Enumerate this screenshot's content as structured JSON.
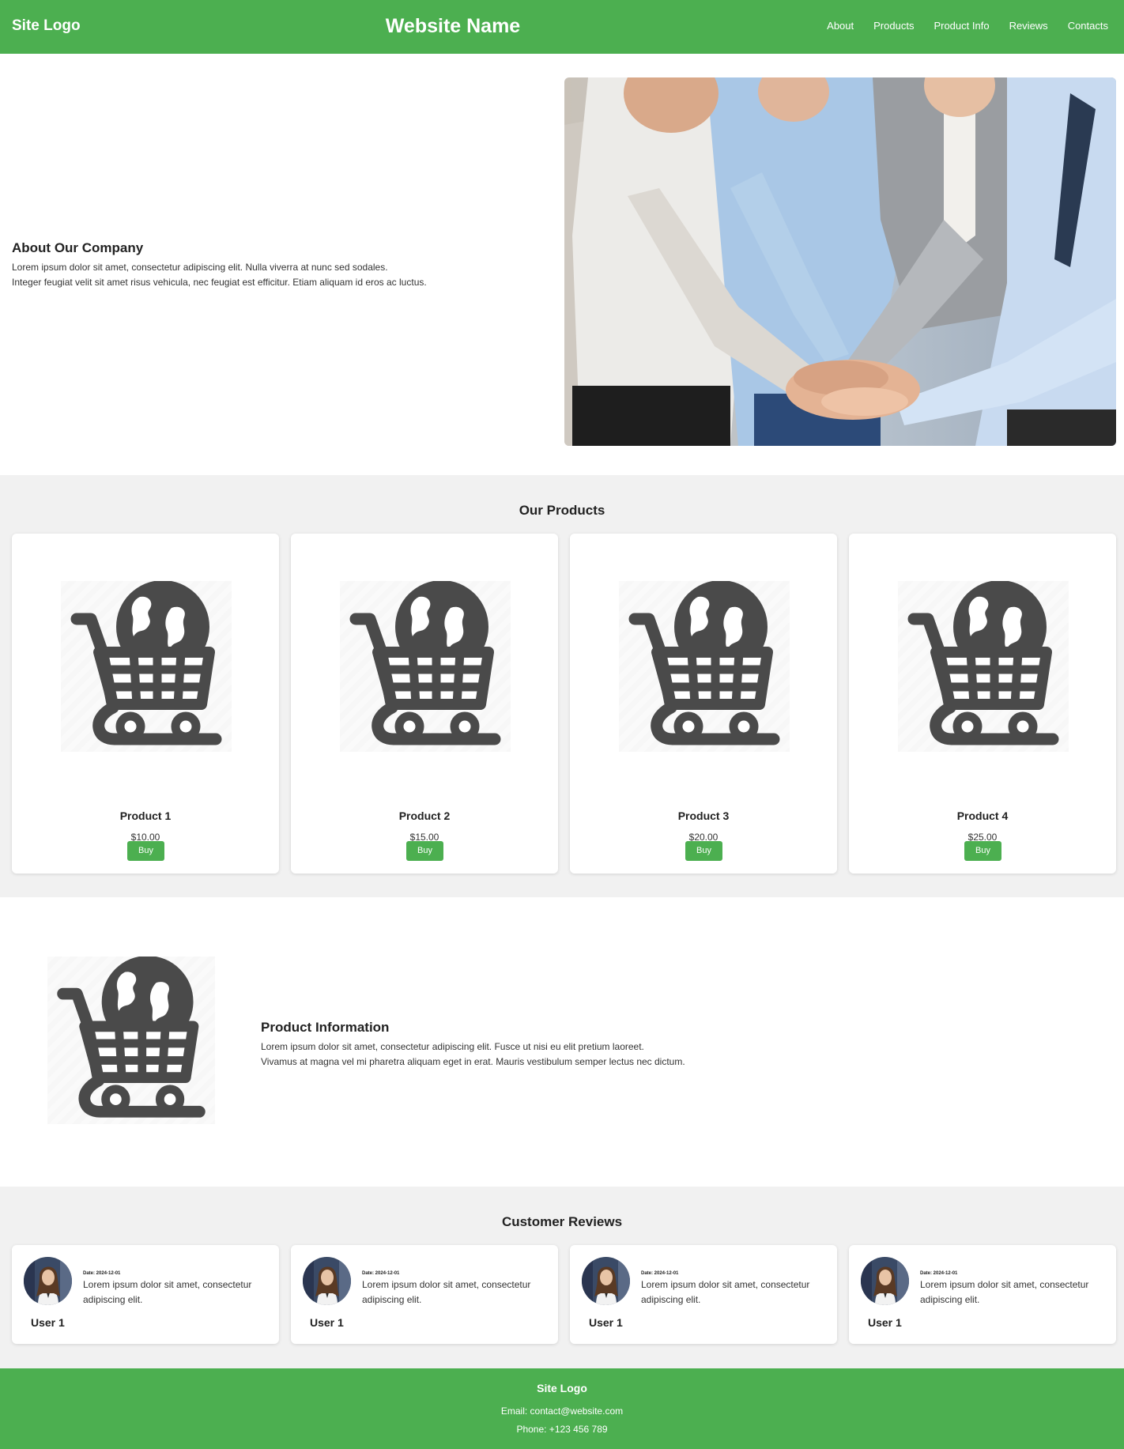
{
  "header": {
    "logo": "Site Logo",
    "site_name": "Website Name",
    "nav": [
      "About",
      "Products",
      "Product Info",
      "Reviews",
      "Contacts"
    ]
  },
  "about": {
    "title": "About Our Company",
    "line1": "Lorem ipsum dolor sit amet, consectetur adipiscing elit. Nulla viverra at nunc sed sodales.",
    "line2": "Integer feugiat velit sit amet risus vehicula, nec feugiat est efficitur. Etiam aliquam id eros ac luctus."
  },
  "products": {
    "title": "Our Products",
    "items": [
      {
        "name": "Product 1",
        "price": "$10.00",
        "button": "Buy"
      },
      {
        "name": "Product 2",
        "price": "$15.00",
        "button": "Buy"
      },
      {
        "name": "Product 3",
        "price": "$20.00",
        "button": "Buy"
      },
      {
        "name": "Product 4",
        "price": "$25.00",
        "button": "Buy"
      }
    ]
  },
  "product_info": {
    "title": "Product Information",
    "line1": "Lorem ipsum dolor sit amet, consectetur adipiscing elit. Fusce ut nisi eu elit pretium laoreet.",
    "line2": "Vivamus at magna vel mi pharetra aliquam eget in erat. Mauris vestibulum semper lectus nec dictum."
  },
  "reviews": {
    "title": "Customer Reviews",
    "items": [
      {
        "date": "Date: 2024-12-01",
        "text": "Lorem ipsum dolor sit amet, consectetur adipiscing elit.",
        "user": "User 1"
      },
      {
        "date": "Date: 2024-12-01",
        "text": "Lorem ipsum dolor sit amet, consectetur adipiscing elit.",
        "user": "User 1"
      },
      {
        "date": "Date: 2024-12-01",
        "text": "Lorem ipsum dolor sit amet, consectetur adipiscing elit.",
        "user": "User 1"
      },
      {
        "date": "Date: 2024-12-01",
        "text": "Lorem ipsum dolor sit amet, consectetur adipiscing elit.",
        "user": "User 1"
      }
    ]
  },
  "footer": {
    "logo": "Site Logo",
    "email": "Email: contact@website.com",
    "phone": "Phone: +123 456 789"
  },
  "colors": {
    "brand_green": "#4caf50",
    "section_gray": "#f1f1f1",
    "icon_gray": "#4a4a4a"
  },
  "icons": {
    "product_image": "shopping-cart-globe-icon",
    "reviewer_avatar": "user-avatar"
  }
}
